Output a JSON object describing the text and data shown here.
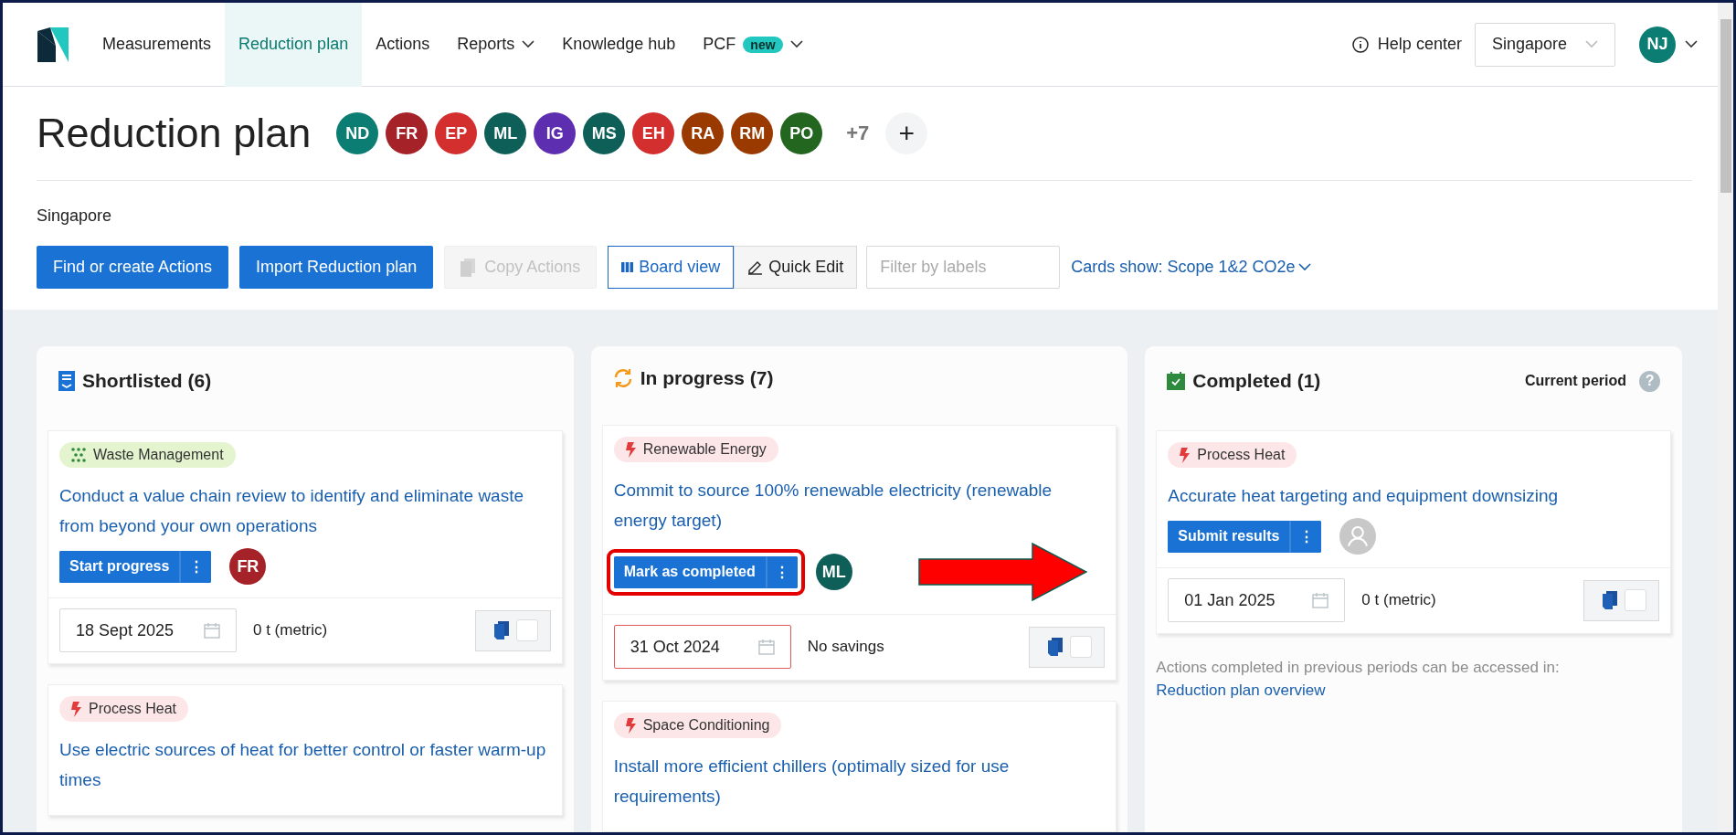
{
  "nav": {
    "items": [
      {
        "label": "Measurements",
        "selected": false,
        "dropdown": false
      },
      {
        "label": "Reduction plan",
        "selected": true,
        "dropdown": false
      },
      {
        "label": "Actions",
        "selected": false,
        "dropdown": false
      },
      {
        "label": "Reports",
        "selected": false,
        "dropdown": true
      },
      {
        "label": "Knowledge hub",
        "selected": false,
        "dropdown": false
      },
      {
        "label": "PCF",
        "selected": false,
        "dropdown": true,
        "badge": "new"
      }
    ],
    "help": "Help center",
    "location": "Singapore",
    "user": {
      "initials": "NJ",
      "color": "#0b7d72"
    }
  },
  "header": {
    "title": "Reduction plan",
    "members": [
      {
        "initials": "ND",
        "color": "#0b7d72"
      },
      {
        "initials": "FR",
        "color": "#a52328"
      },
      {
        "initials": "EP",
        "color": "#d32f2f"
      },
      {
        "initials": "ML",
        "color": "#0e5f58"
      },
      {
        "initials": "IG",
        "color": "#5e2eb0"
      },
      {
        "initials": "MS",
        "color": "#0e5f58"
      },
      {
        "initials": "EH",
        "color": "#d32f2f"
      },
      {
        "initials": "RA",
        "color": "#9a3a00"
      },
      {
        "initials": "RM",
        "color": "#9a3a00"
      },
      {
        "initials": "PO",
        "color": "#23661f"
      }
    ],
    "more_members": "+7",
    "add": "+",
    "subtitle": "Singapore",
    "toolbar": [
      {
        "kind": "primary",
        "label": "Find or create Actions",
        "disabled": false
      },
      {
        "kind": "primary",
        "label": "Import Reduction plan",
        "disabled": false
      },
      {
        "kind": "copy",
        "label": "Copy Actions",
        "disabled": true
      }
    ],
    "views": [
      {
        "label": "Board view",
        "kind": "board",
        "selected": true
      },
      {
        "label": "Quick Edit",
        "kind": "edit",
        "selected": false
      }
    ],
    "filter": {
      "placeholder": "Filter by labels"
    },
    "cards_show": "Cards show: Scope 1&2 CO2e"
  },
  "columns": [
    {
      "title": "Shortlisted (6)",
      "kind": "shortlist",
      "cards": [
        {
          "tag": {
            "label": "Waste Management",
            "kind": "waste"
          },
          "title": "Conduct a value chain review to identify and eliminate waste from beyond your own operations",
          "action": "Start progress",
          "menu": "⋮",
          "highlighted": false,
          "arrow": false,
          "assignee": {
            "initials": "FR",
            "color": "#a52328"
          },
          "date": "18 Sept 2025",
          "date_invalid": false,
          "savings": "0 t (metric)",
          "checked": false
        },
        {
          "tag": {
            "label": "Process Heat",
            "kind": "heat"
          },
          "title": "Use electric sources of heat for better control or faster warm-up times"
        }
      ]
    },
    {
      "title": "In progress (7)",
      "kind": "progress",
      "cards": [
        {
          "tag": {
            "label": "Renewable Energy",
            "kind": "heat"
          },
          "title": "Commit to source 100% renewable electricity (renewable energy target)",
          "action": "Mark as completed",
          "menu": "⋮",
          "highlighted": true,
          "arrow": true,
          "assignee": {
            "initials": "ML",
            "color": "#0e5f58"
          },
          "date": "31 Oct 2024",
          "date_invalid": true,
          "savings": "No savings",
          "checked": false
        },
        {
          "tag": {
            "label": "Space Conditioning",
            "kind": "heat"
          },
          "title": "Install more efficient chillers (optimally sized for use requirements)"
        }
      ]
    },
    {
      "title": "Completed (1)",
      "kind": "completed",
      "period": "Current period",
      "help": "?",
      "cards": [
        {
          "tag": {
            "label": "Process Heat",
            "kind": "heat"
          },
          "title": "Accurate heat targeting and equipment downsizing",
          "action": "Submit results",
          "menu": "⋮",
          "highlighted": false,
          "arrow": false,
          "date": "01 Jan 2025",
          "date_invalid": false,
          "savings": "0 t (metric)",
          "checked": false
        }
      ],
      "note": "Actions completed in previous periods can be accessed in:",
      "note_link": "Reduction plan overview"
    }
  ]
}
